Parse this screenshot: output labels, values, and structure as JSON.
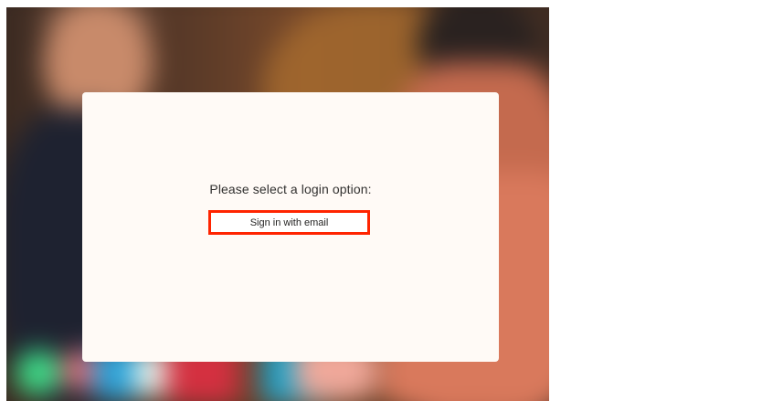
{
  "login": {
    "prompt": "Please select a login option:",
    "options": [
      {
        "label": "Sign in with email"
      }
    ]
  },
  "colors": {
    "card_background": "#fffaf6",
    "highlight_border": "#ff2400",
    "text": "#323130"
  }
}
